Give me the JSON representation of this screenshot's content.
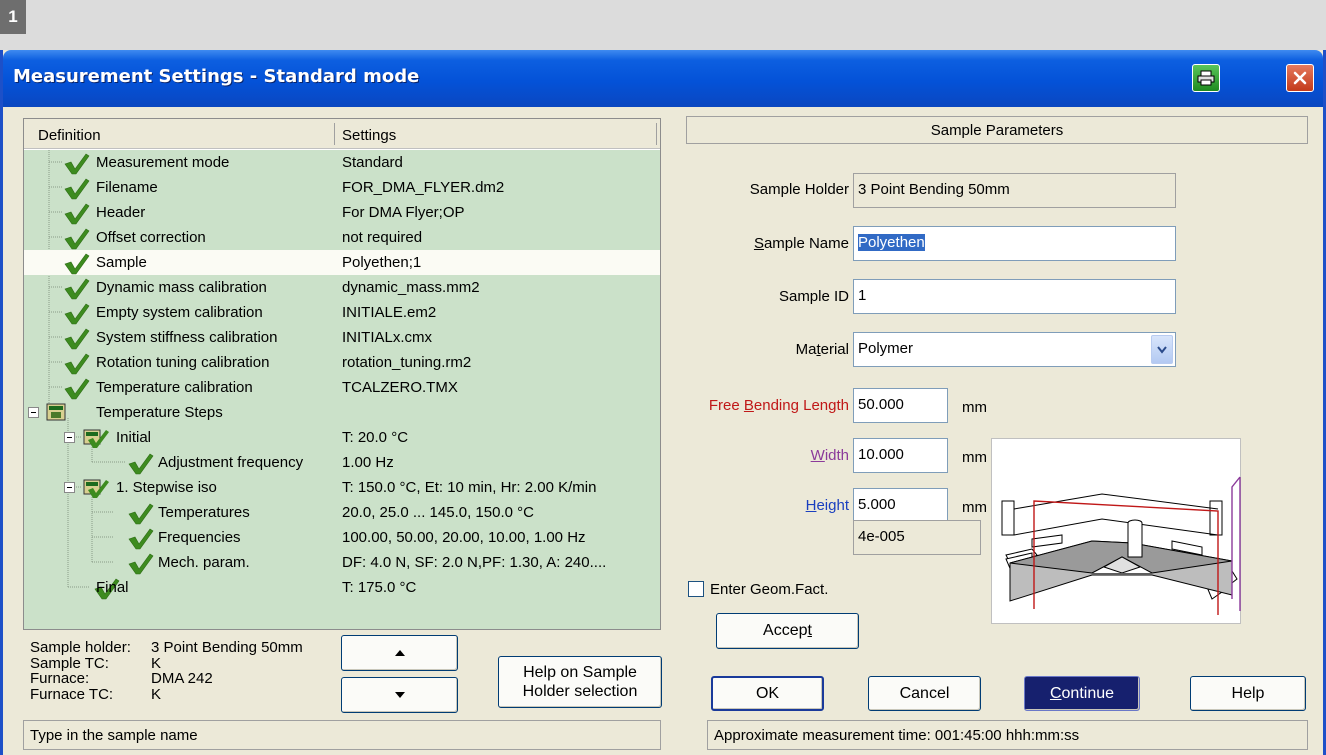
{
  "badge": "1",
  "window": {
    "title": "Measurement Settings - Standard mode"
  },
  "tree": {
    "col_definition": "Definition",
    "col_settings": "Settings",
    "rows": [
      {
        "label": "Measurement mode",
        "value": "Standard",
        "icon": "check-icon"
      },
      {
        "label": "Filename",
        "value": "FOR_DMA_FLYER.dm2",
        "icon": "check-icon"
      },
      {
        "label": "Header",
        "value": "For DMA Flyer;OP",
        "icon": "check-icon"
      },
      {
        "label": "Offset correction",
        "value": "not required",
        "icon": "check-icon"
      },
      {
        "label": "Sample",
        "value": "Polyethen;1",
        "icon": "check-icon",
        "selected": true
      },
      {
        "label": "Dynamic mass calibration",
        "value": "dynamic_mass.mm2",
        "icon": "check-icon"
      },
      {
        "label": "Empty system calibration",
        "value": "INITIALE.em2",
        "icon": "check-icon"
      },
      {
        "label": "System stiffness calibration",
        "value": "INITIALx.cmx",
        "icon": "check-icon"
      },
      {
        "label": "Rotation tuning calibration",
        "value": "rotation_tuning.rm2",
        "icon": "check-icon"
      },
      {
        "label": "Temperature calibration",
        "value": "TCALZERO.TMX",
        "icon": "check-icon"
      },
      {
        "label": "Temperature Steps",
        "value": "",
        "icon": "steps-icon"
      },
      {
        "label": "Initial",
        "value": "T: 20.0 °C",
        "icon": "step-check-icon"
      },
      {
        "label": "Adjustment frequency",
        "value": "1.00 Hz",
        "icon": "check-icon"
      },
      {
        "label": "1. Stepwise iso",
        "value": "T: 150.0 °C, Et: 10 min, Hr: 2.00 K/min",
        "icon": "step-check-icon"
      },
      {
        "label": "Temperatures",
        "value": "20.0, 25.0 ... 145.0, 150.0 °C",
        "icon": "check-icon"
      },
      {
        "label": "Frequencies",
        "value": "100.00, 50.00, 20.00, 10.00, 1.00 Hz",
        "icon": "check-icon"
      },
      {
        "label": "Mech. param.",
        "value": "DF: 4.0 N, SF: 2.0 N,PF: 1.30, A: 240....",
        "icon": "check-icon"
      },
      {
        "label": "Final",
        "value": "T: 175.0 °C",
        "icon": "check-icon"
      }
    ]
  },
  "info": {
    "sample_holder_label": "Sample holder:",
    "sample_holder_value": "3 Point Bending 50mm",
    "sample_tc_label": "Sample TC:",
    "sample_tc_value": "K",
    "furnace_label": "Furnace:",
    "furnace_value": "DMA 242",
    "furnace_tc_label": "Furnace TC:",
    "furnace_tc_value": "K"
  },
  "buttons": {
    "help_sample_holder_line1": "Help on Sample",
    "help_sample_holder_line2": "Holder selection",
    "accept_pre": "Accep",
    "accept_u": "t",
    "ok": "OK",
    "cancel": "Cancel",
    "continue_u": "C",
    "continue_post": "ontinue",
    "help": "Help"
  },
  "status": {
    "left": "Type in the sample name",
    "right": "Approximate measurement time: 001:45:00 hhh:mm:ss"
  },
  "sample_params": {
    "header": "Sample Parameters",
    "holder_label": "Sample Holder",
    "holder_value": "3 Point Bending 50mm",
    "name_label_u": "S",
    "name_label_post": "ample Name",
    "name_value": "Polyethen",
    "id_label": "Sample ID",
    "id_value": "1",
    "material_label_pre": "Ma",
    "material_label_u": "t",
    "material_label_post": "erial",
    "material_value": "Polymer",
    "free_len_label_pre": "Free ",
    "free_len_label_u": "B",
    "free_len_label_post": "ending Length",
    "free_len_value": "50.000",
    "free_len_unit": "mm",
    "width_label_u": "W",
    "width_label_post": "idth",
    "width_value": "10.000",
    "width_unit": "mm",
    "height_label_u": "H",
    "height_label_post": "eight",
    "height_value": "5.000",
    "height_unit": "mm",
    "geom_label": "Enter Geom.Fact.",
    "geom_value": "4e-005",
    "geom_checked": false
  },
  "colors": {
    "title_bar": "#0452d8",
    "tree_bg": "#cbe1c9",
    "check": "#3d8b1f",
    "free_len_label": "#c01818",
    "width_label": "#8b3a9a",
    "height_label": "#1a3fbf",
    "continue_bg": "#16206e"
  }
}
